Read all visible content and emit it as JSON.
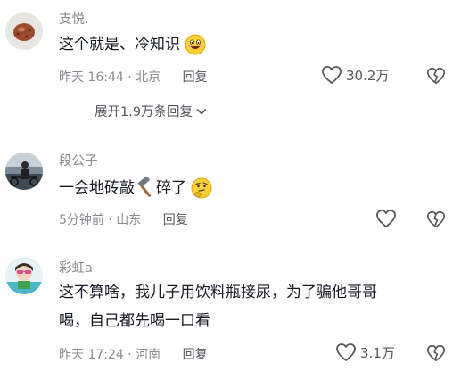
{
  "comments": [
    {
      "username": "支悦.",
      "text": "这个就是、冷知识",
      "emoji": "grinning-face-emoji",
      "time": "昨天 16:44",
      "location": "北京",
      "reply_label": "回复",
      "likes": "30.2万",
      "expand_label": "展开1.9万条回复"
    },
    {
      "username": "段公子",
      "text_before": "一会地砖敲",
      "emoji_mid": "hammer-emoji",
      "text_after": "碎了",
      "emoji_end": "thinking-face-emoji",
      "time": "5分钟前",
      "location": "山东",
      "reply_label": "回复"
    },
    {
      "username": "彩虹a",
      "line1": "这不算啥，我儿子用饮料瓶接尿，为了骗他哥哥",
      "line2": "喝，自己都先喝一口看",
      "time": "昨天 17:24",
      "location": "河南",
      "reply_label": "回复",
      "likes": "3.1万"
    }
  ],
  "separator": "·",
  "colors": {
    "text": "#161823",
    "muted": "#8a8b91",
    "action": "#55565c"
  }
}
